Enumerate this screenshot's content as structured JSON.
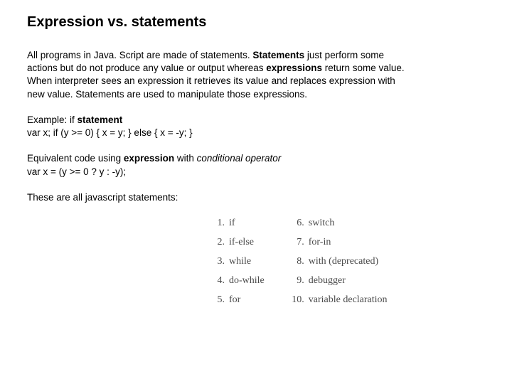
{
  "title": "Expression vs. statements",
  "p1": {
    "s1": "All programs in Java. Script are made of statements. ",
    "b1": "Statements",
    "s2": " just perform some actions but do not produce any value or output whereas ",
    "b2": "expressions",
    "s3": " return some value. When interpreter sees an expression it retrieves its value and replaces expression with new value. Statements are used to manipulate those expressions."
  },
  "p2": {
    "s1": "Example: if ",
    "b1": "statement",
    "code": "var x; if (y >= 0) { x = y; } else { x = -y; }"
  },
  "p3": {
    "s1": "Equivalent code using ",
    "b1": "expression",
    "s2": " with ",
    "i1": "conditional operator",
    "code": "var x = (y >= 0 ? y : -y);"
  },
  "p4": "These are all javascript statements:",
  "list": {
    "col1": [
      {
        "n": "1.",
        "t": "if"
      },
      {
        "n": "2.",
        "t": "if-else"
      },
      {
        "n": "3.",
        "t": "while"
      },
      {
        "n": "4.",
        "t": "do-while"
      },
      {
        "n": "5.",
        "t": "for"
      }
    ],
    "col2": [
      {
        "n": "6.",
        "t": "switch"
      },
      {
        "n": "7.",
        "t": "for-in"
      },
      {
        "n": "8.",
        "t": "with (deprecated)"
      },
      {
        "n": "9.",
        "t": "debugger"
      },
      {
        "n": "10.",
        "t": "variable declaration"
      }
    ]
  }
}
